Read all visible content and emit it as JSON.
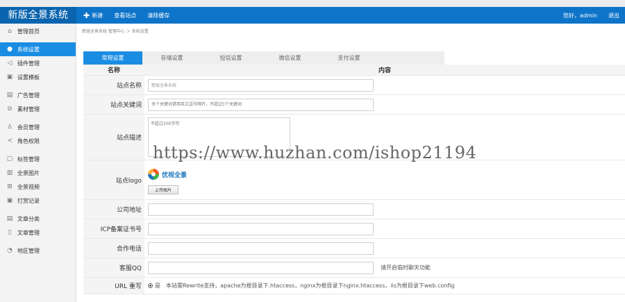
{
  "app": {
    "title": "新版全景系统"
  },
  "header": {
    "nav": [
      {
        "label": "新建",
        "icon": "plus-icon"
      },
      {
        "label": "查看站点"
      },
      {
        "label": "清除缓存"
      }
    ],
    "greeting": "您好，admin",
    "logout": "退出"
  },
  "sidebar": {
    "items": [
      {
        "label": "管理首页",
        "icon": "home-icon",
        "active": false
      },
      {
        "label": "系统设置",
        "icon": "gear-icon",
        "active": true
      },
      {
        "label": "插件管理",
        "icon": "plane-icon",
        "active": false
      },
      {
        "label": "设置模板",
        "icon": "template-icon",
        "active": false
      },
      {
        "label": "广告管理",
        "icon": "ad-icon",
        "active": false
      },
      {
        "label": "素材管理",
        "icon": "clip-icon",
        "active": false
      },
      {
        "label": "会员管理",
        "icon": "member-icon",
        "active": false
      },
      {
        "label": "角色权限",
        "icon": "share-icon",
        "active": false
      },
      {
        "label": "标签管理",
        "icon": "tag-icon",
        "active": false
      },
      {
        "label": "全景图片",
        "icon": "image-icon",
        "active": false
      },
      {
        "label": "全景视频",
        "icon": "grid-icon",
        "active": false
      },
      {
        "label": "打赏记录",
        "icon": "record-icon",
        "active": false
      },
      {
        "label": "文章分类",
        "icon": "category-icon",
        "active": false
      },
      {
        "label": "文章管理",
        "icon": "file-icon",
        "active": false
      },
      {
        "label": "地区管理",
        "icon": "region-icon",
        "active": false
      }
    ]
  },
  "breadcrumb": "新版全景系统 管理中心 ＞ 系统设置",
  "tabs": [
    "常规设置",
    "存储设置",
    "短信设置",
    "微信设置",
    "支付设置"
  ],
  "table": {
    "col_name": "名称",
    "col_content": "内容"
  },
  "form": {
    "site_name": {
      "label": "站点名称",
      "value": "新版全景系统"
    },
    "keywords": {
      "label": "站点关键词",
      "placeholder": "多个关键词请用英文逗号隔开，不超过5个关键词"
    },
    "description": {
      "label": "站点描述",
      "placeholder": "不超过200字符"
    },
    "logo": {
      "label": "站点logo",
      "logo_text": "优视全景",
      "upload_label": "上传图片"
    },
    "address": {
      "label": "公司地址",
      "value": ""
    },
    "icp": {
      "label": "ICP备案证书号",
      "value": ""
    },
    "phone": {
      "label": "合作电话",
      "value": ""
    },
    "qq": {
      "label": "客服QQ",
      "value": "",
      "hint": "请开启临时聊天功能"
    },
    "url_rewrite": {
      "label": "URL 重写",
      "option": "是",
      "note": "本站需Rewrite支持，apache为根目录下.htaccess，nginx为根目录下nginx.htaccess，iis为根目录下web.config"
    }
  },
  "watermark": "https://www.huzhan.com/ishop21194"
}
